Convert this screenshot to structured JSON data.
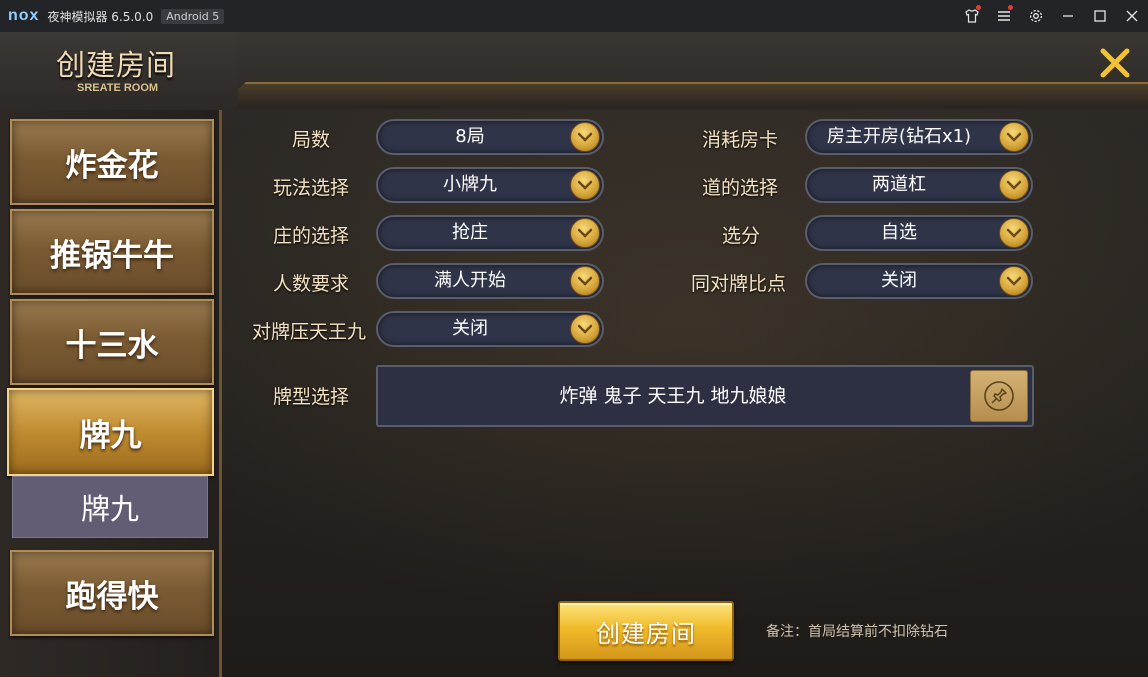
{
  "window": {
    "logo": "nox",
    "title": "夜神模拟器 6.5.0.0",
    "android": "Android 5"
  },
  "header": {
    "title": "创建房间",
    "subtitle": "SREATE ROOM"
  },
  "sidebar": {
    "tabs": [
      {
        "label": "炸金花",
        "active": false
      },
      {
        "label": "推锅牛牛",
        "active": false
      },
      {
        "label": "十三水",
        "active": false
      },
      {
        "label": "牌九",
        "active": true
      },
      {
        "label": "跑得快",
        "active": false
      }
    ],
    "sub_tab": "牌九"
  },
  "form": {
    "left": [
      {
        "label": "局数",
        "value": "8局"
      },
      {
        "label": "玩法选择",
        "value": "小牌九"
      },
      {
        "label": "庄的选择",
        "value": "抢庄"
      },
      {
        "label": "人数要求",
        "value": "满人开始"
      },
      {
        "label": "对牌压天王九",
        "value": "关闭"
      }
    ],
    "right": [
      {
        "label": "消耗房卡",
        "value": "房主开房(钻石x1)"
      },
      {
        "label": "道的选择",
        "value": "两道杠"
      },
      {
        "label": "选分",
        "value": "自选"
      },
      {
        "label": "同对牌比点",
        "value": "关闭"
      }
    ],
    "pattern_label": "牌型选择",
    "pattern_value": "炸弹 鬼子 天王九 地九娘娘"
  },
  "actions": {
    "create_label": "创建房间",
    "note": "备注：首局结算前不扣除钻石"
  },
  "colors": {
    "accent_gold": "#f0bb2a",
    "label_text": "#f4e3c2",
    "select_bg": "#2f3448",
    "subtab_bg": "#625c74"
  }
}
